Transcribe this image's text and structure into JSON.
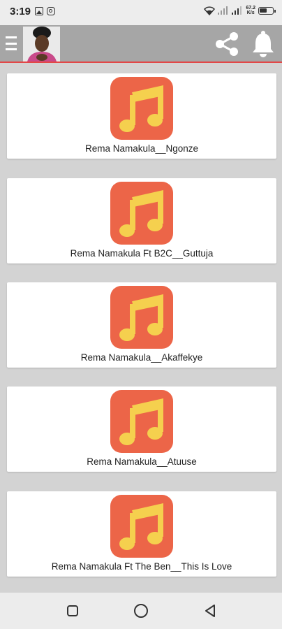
{
  "status_bar": {
    "time": "3:19",
    "net_speed_value": "67.2",
    "net_speed_unit": "K/s"
  },
  "colors": {
    "accent": "#e34747",
    "music_icon_bg": "#ec6548",
    "music_note": "#f5d04e",
    "appbar_bg": "#a6a6a6"
  },
  "app_bar": {
    "icons": [
      "menu-icon",
      "avatar",
      "share-icon",
      "bell-icon"
    ]
  },
  "songs": [
    {
      "title": "Rema Namakula__Ngonze",
      "icon": "music-note-icon"
    },
    {
      "title": "Rema Namakula Ft B2C__Guttuja",
      "icon": "music-note-icon"
    },
    {
      "title": "Rema Namakula__Akaffekye",
      "icon": "music-note-icon"
    },
    {
      "title": "Rema Namakula__Atuuse",
      "icon": "music-note-icon"
    },
    {
      "title": "Rema Namakula Ft The Ben__This Is Love",
      "icon": "music-note-icon"
    }
  ],
  "nav_bar": {
    "icons": [
      "recent-apps-icon",
      "home-icon",
      "back-icon"
    ]
  }
}
